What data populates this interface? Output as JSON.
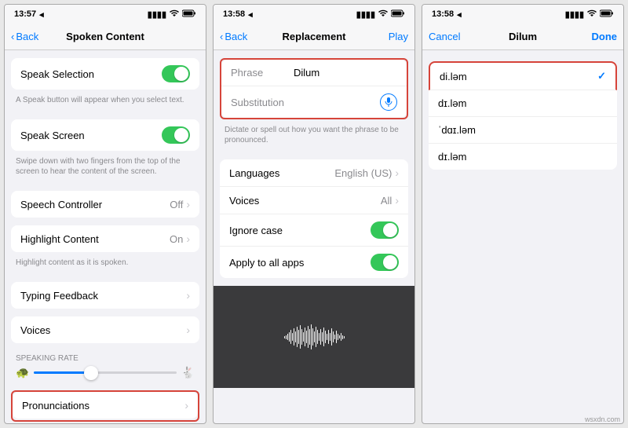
{
  "status": {
    "time1": "13:57",
    "time2": "13:58",
    "time3": "13:58",
    "loc": "◂"
  },
  "screen1": {
    "back": "Back",
    "title": "Spoken Content",
    "speakSelection": "Speak Selection",
    "speakSelectionHint": "A Speak button will appear when you select text.",
    "speakScreen": "Speak Screen",
    "speakScreenHint": "Swipe down with two fingers from the top of the screen to hear the content of the screen.",
    "speechController": "Speech Controller",
    "speechControllerValue": "Off",
    "highlightContent": "Highlight Content",
    "highlightContentValue": "On",
    "highlightContentHint": "Highlight content as it is spoken.",
    "typingFeedback": "Typing Feedback",
    "voices": "Voices",
    "speakingRate": "SPEAKING RATE",
    "pronunciations": "Pronunciations"
  },
  "screen2": {
    "back": "Back",
    "title": "Replacement",
    "play": "Play",
    "phraseLabel": "Phrase",
    "phraseValue": "Dilum",
    "substitutionLabel": "Substitution",
    "hint": "Dictate or spell out how you want the phrase to be pronounced.",
    "languages": "Languages",
    "languagesValue": "English (US)",
    "voices": "Voices",
    "voicesValue": "All",
    "ignoreCase": "Ignore case",
    "applyAll": "Apply to all apps"
  },
  "screen3": {
    "cancel": "Cancel",
    "title": "Dilum",
    "done": "Done",
    "options": [
      "di.ləm",
      "dɪ.ləm",
      "ˈdɑɪ.ləm",
      "dɪ.ləm"
    ],
    "selected": 0
  },
  "watermark": "wsxdn.com"
}
